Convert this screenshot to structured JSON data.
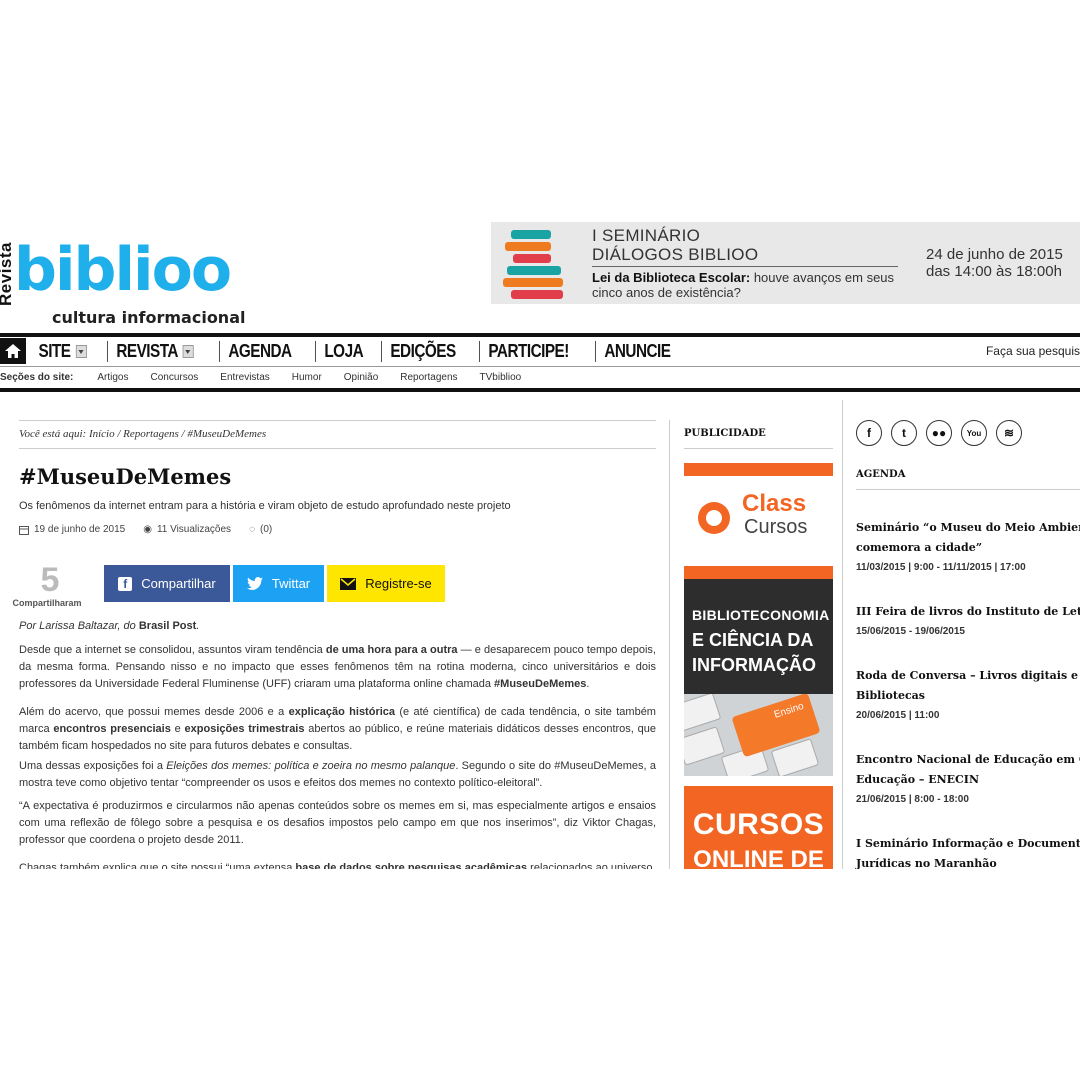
{
  "header": {
    "logo_vertical": "Revista",
    "logo_word": "biblioo",
    "logo_tagline": "cultura informacional"
  },
  "banner": {
    "title_line1": "I SEMINÁRIO",
    "title_line2": "DIÁLOGOS BIBLIOO",
    "subtitle_bold": "Lei da Biblioteca Escolar:",
    "subtitle_rest": " houve avanços em seus",
    "subtitle_line2": "cinco anos de existência?",
    "date_line1": "24 de junho de 2015",
    "date_line2": "das 14:00 às 18:00h"
  },
  "nav": {
    "items": [
      {
        "label": "SITE",
        "has_caret": true
      },
      {
        "label": "REVISTA",
        "has_caret": true
      },
      {
        "label": "AGENDA",
        "has_caret": false
      },
      {
        "label": "LOJA",
        "has_caret": false
      },
      {
        "label": "EDIÇÕES",
        "has_caret": false
      },
      {
        "label": "PARTICIPE!",
        "has_caret": false
      },
      {
        "label": "ANUNCIE",
        "has_caret": false
      }
    ],
    "search_placeholder": "Faça sua pesquis"
  },
  "sections": {
    "label": "Seções do site:",
    "items": [
      "Artigos",
      "Concursos",
      "Entrevistas",
      "Humor",
      "Opinião",
      "Reportagens",
      "TVbiblioo"
    ]
  },
  "article": {
    "breadcrumb": "Você está aqui: Início / Reportagens / #MuseuDeMemes",
    "title": "#MuseuDeMemes",
    "subtitle": "Os fenômenos da internet entram para a história e viram objeto de estudo aprofundado neste projeto",
    "date": "19 de junho de 2015",
    "views": "11 Visualizações",
    "comments": "(0)",
    "share_count": "5",
    "share_label": "Compartilharam",
    "btn_facebook": "Compartilhar",
    "btn_twitter": "Twittar",
    "btn_register": "Registre-se",
    "byline_pre": "Por Larissa Baltazar, do ",
    "byline_src": "Brasil Post",
    "byline_end": ".",
    "p1": [
      {
        "t": "Desde que a internet se consolidou, assuntos viram tendência ",
        "b": false
      },
      {
        "t": "de uma hora para a outra",
        "b": true
      },
      {
        "t": " — e desaparecem pouco tempo depois, da mesma forma. Pensando nisso e no impacto que esses fenômenos têm na rotina moderna, cinco universitários e dois professores da Universidade Federal Fluminense (UFF) criaram uma plataforma online chamada ",
        "b": false
      },
      {
        "t": "#MuseuDeMemes",
        "b": true
      },
      {
        "t": ".",
        "b": false
      }
    ],
    "p2": [
      {
        "t": "Além do acervo, que possui memes desde 2006 e a ",
        "b": false
      },
      {
        "t": "explicação histórica",
        "b": true
      },
      {
        "t": " (e até científica) de cada tendência, o site também marca ",
        "b": false
      },
      {
        "t": "encontros presenciais",
        "b": true
      },
      {
        "t": " e ",
        "b": false
      },
      {
        "t": "exposições trimestrais",
        "b": true
      },
      {
        "t": " abertos ao público, e reúne materiais didáticos desses encontros, que também ficam hospedados no site para futuros debates e consultas.",
        "b": false
      }
    ],
    "p3": [
      {
        "t": "Uma dessas exposições foi a ",
        "b": false
      },
      {
        "t": "Eleições dos memes: política e zoeira no mesmo palanque",
        "i": true
      },
      {
        "t": ". Segundo o site do #MuseuDeMemes, a mostra teve como objetivo tentar “compreender os usos e efeitos dos memes no contexto político-eleitoral”.",
        "b": false
      }
    ],
    "p4": "“A expectativa é produzirmos e circularmos não apenas conteúdos sobre os memes em si, mas especialmente artigos e ensaios com uma reflexão de fôlego sobre a pesquisa e os desafios impostos pelo campo em que nos inserimos”, diz Viktor Chagas, professor que coordena o projeto desde 2011.",
    "p5": [
      {
        "t": "Chagas também explica que o site possui “uma extensa ",
        "b": false
      },
      {
        "t": "base de dados sobre pesquisas acadêmicas",
        "b": true
      },
      {
        "t": " relacionados ao universo",
        "b": false
      }
    ]
  },
  "ads": {
    "heading": "PUBLICIDADE",
    "ad1_line1": "Class",
    "ad1_line2": "Cursos",
    "ad2_line1": "BIBLIOTECONOMIA",
    "ad2_line2": "E CIÊNCIA DA",
    "ad2_line3": "INFORMAÇÃO",
    "ad2_key": "Ensino",
    "ad3_line1": "CURSOS",
    "ad3_line2": "ONLINE DE"
  },
  "sidebar": {
    "social_icons": [
      "facebook-icon",
      "twitter-icon",
      "flickr-icon",
      "youtube-icon",
      "rss-icon"
    ],
    "social_glyphs": [
      "f",
      "t",
      "●●",
      "You",
      "≋"
    ],
    "agenda_heading": "AGENDA",
    "events": [
      {
        "title1": "Seminário “o Museu do Meio Ambiente",
        "title2": "comemora a cidade”",
        "date": "11/03/2015 | 9:00 - 11/11/2015 | 17:00"
      },
      {
        "title1": "III Feira de livros do Instituto de Letras",
        "title2": "",
        "date": "15/06/2015 - 19/06/2015"
      },
      {
        "title1": "Roda de Conversa – Livros digitais e as",
        "title2": "Bibliotecas",
        "date": "20/06/2015 | 11:00"
      },
      {
        "title1": "Encontro Nacional de Educação em Ciên",
        "title2": "Educação – ENECIN",
        "date": "21/06/2015 | 8:00 - 18:00"
      },
      {
        "title1": "I Seminário Informação e Documentaçã",
        "title2": "Jurídicas no Maranhão",
        "date": ""
      }
    ]
  },
  "colors": {
    "brand_blue": "#1fb0ec",
    "ad_orange": "#f26522",
    "facebook": "#3b5998",
    "twitter": "#1da1f2",
    "register_yellow": "#ffe600"
  }
}
